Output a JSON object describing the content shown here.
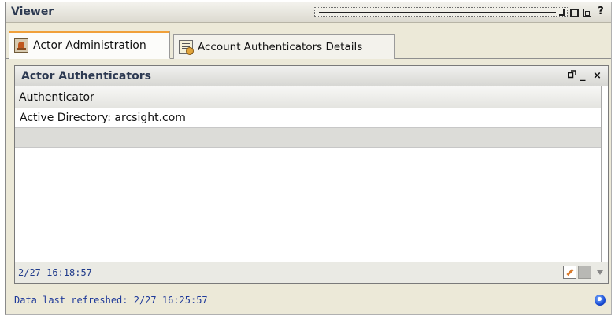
{
  "viewer": {
    "title": "Viewer",
    "help_label": "?"
  },
  "tabs": [
    {
      "label": "Actor Administration",
      "icon": "actor-admin-icon",
      "active": true
    },
    {
      "label": "Account Authenticators Details",
      "icon": "account-details-icon",
      "active": false
    }
  ],
  "panel": {
    "title": "Actor Authenticators",
    "close_label": "×",
    "minimize_label": "_",
    "columns": [
      "Authenticator"
    ],
    "rows": [
      {
        "authenticator": "Active Directory: arcsight.com",
        "selected": false
      },
      {
        "authenticator": "",
        "selected": true
      }
    ],
    "status_time": "2/27 16:18:57"
  },
  "footer": {
    "status_text": "Data last refreshed: 2/27 16:25:57"
  }
}
